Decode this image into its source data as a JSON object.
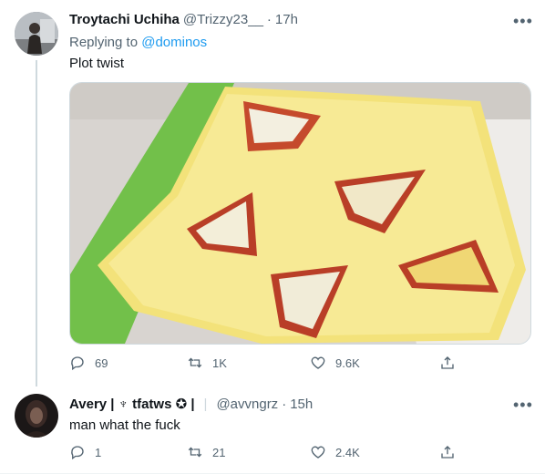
{
  "tweet": {
    "author_name": "Troytachi Uchiha",
    "handle": "@Trizzy23__",
    "separator": "·",
    "time": "17h",
    "replying_prefix": "Replying to ",
    "replying_to": "@dominos",
    "text": "Plot twist",
    "actions": {
      "replies": "69",
      "retweets": "1K",
      "likes": "9.6K"
    }
  },
  "reply": {
    "author_name": "Avery | ♆ tfatws ✪ |",
    "handle": "@avvngrz",
    "separator": "·",
    "time": "15h",
    "text": "man what the fuck",
    "actions": {
      "replies": "1",
      "retweets": "21",
      "likes": "2.4K"
    }
  },
  "icons": [
    "reply-icon",
    "retweet-icon",
    "like-icon",
    "share-icon",
    "more-icon"
  ],
  "colors": {
    "link": "#1d9bf0",
    "muted": "#536471",
    "text": "#0f1419",
    "cutting_board": "#6fbf43",
    "pineapple": "#f4e27a"
  }
}
